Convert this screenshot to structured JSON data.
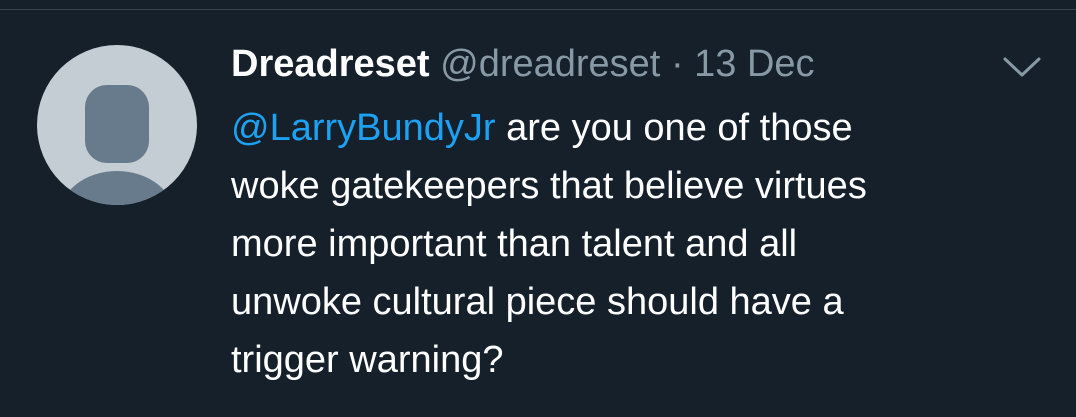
{
  "tweet": {
    "author_name": "Dreadreset",
    "author_handle": "@dreadreset",
    "separator": "·",
    "date": "13 Dec",
    "mention": "@LarryBundyJr",
    "text_lines": [
      " are you one of those",
      "woke gatekeepers that believe virtues",
      "more important than talent and all",
      "unwoke cultural piece should have a",
      "trigger warning?"
    ]
  },
  "icons": {
    "avatar": "default-avatar-icon",
    "menu": "chevron-down-icon"
  },
  "colors": {
    "background": "#15202b",
    "text": "#ffffff",
    "secondary_text": "#8899a6",
    "link": "#1da1f2",
    "avatar_bg": "#c4ccd4",
    "avatar_figure": "#687b8c"
  }
}
